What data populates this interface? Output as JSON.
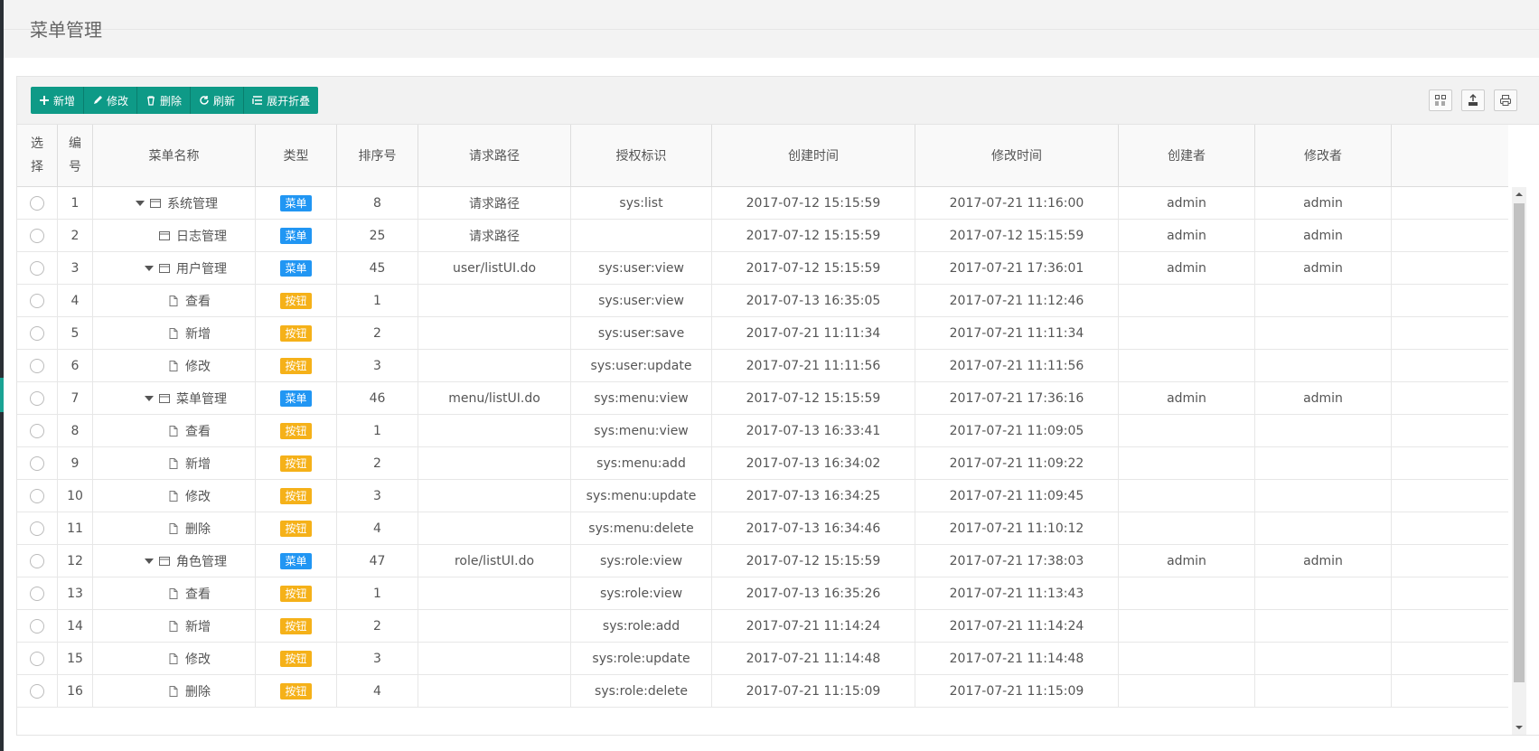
{
  "header": {
    "title": "菜单管理"
  },
  "toolbar": {
    "buttons": [
      {
        "label": "新增"
      },
      {
        "label": "修改"
      },
      {
        "label": "删除"
      },
      {
        "label": "刷新"
      },
      {
        "label": "展开折叠"
      }
    ],
    "icons": [
      "columns-icon",
      "export-icon",
      "print-icon"
    ]
  },
  "table": {
    "columns": [
      "选择",
      "编号",
      "菜单名称",
      "类型",
      "排序号",
      "请求路径",
      "授权标识",
      "创建时间",
      "修改时间",
      "创建者",
      "修改者"
    ],
    "rows": [
      {
        "id": "1",
        "name": "系统管理",
        "level": 0,
        "node": "folder-expanded",
        "type": "菜单",
        "kind": "menu",
        "sort": "8",
        "url": "请求路径",
        "perm": "sys:list",
        "created": "2017-07-12 15:15:59",
        "modified": "2017-07-21 11:16:00",
        "creator": "admin",
        "modifier": "admin"
      },
      {
        "id": "2",
        "name": "日志管理",
        "level": 1,
        "node": "folder",
        "type": "菜单",
        "kind": "menu",
        "sort": "25",
        "url": "请求路径",
        "perm": "",
        "created": "2017-07-12 15:15:59",
        "modified": "2017-07-12 15:15:59",
        "creator": "admin",
        "modifier": "admin"
      },
      {
        "id": "3",
        "name": "用户管理",
        "level": 1,
        "node": "folder-expanded",
        "type": "菜单",
        "kind": "menu",
        "sort": "45",
        "url": "user/listUI.do",
        "perm": "sys:user:view",
        "created": "2017-07-12 15:15:59",
        "modified": "2017-07-21 17:36:01",
        "creator": "admin",
        "modifier": "admin"
      },
      {
        "id": "4",
        "name": "查看",
        "level": 2,
        "node": "file",
        "type": "按钮",
        "kind": "button",
        "sort": "1",
        "url": "",
        "perm": "sys:user:view",
        "created": "2017-07-13 16:35:05",
        "modified": "2017-07-21 11:12:46",
        "creator": "",
        "modifier": ""
      },
      {
        "id": "5",
        "name": "新增",
        "level": 2,
        "node": "file",
        "type": "按钮",
        "kind": "button",
        "sort": "2",
        "url": "",
        "perm": "sys:user:save",
        "created": "2017-07-21 11:11:34",
        "modified": "2017-07-21 11:11:34",
        "creator": "",
        "modifier": ""
      },
      {
        "id": "6",
        "name": "修改",
        "level": 2,
        "node": "file",
        "type": "按钮",
        "kind": "button",
        "sort": "3",
        "url": "",
        "perm": "sys:user:update",
        "created": "2017-07-21 11:11:56",
        "modified": "2017-07-21 11:11:56",
        "creator": "",
        "modifier": ""
      },
      {
        "id": "7",
        "name": "菜单管理",
        "level": 1,
        "node": "folder-expanded",
        "type": "菜单",
        "kind": "menu",
        "sort": "46",
        "url": "menu/listUI.do",
        "perm": "sys:menu:view",
        "created": "2017-07-12 15:15:59",
        "modified": "2017-07-21 17:36:16",
        "creator": "admin",
        "modifier": "admin"
      },
      {
        "id": "8",
        "name": "查看",
        "level": 2,
        "node": "file",
        "type": "按钮",
        "kind": "button",
        "sort": "1",
        "url": "",
        "perm": "sys:menu:view",
        "created": "2017-07-13 16:33:41",
        "modified": "2017-07-21 11:09:05",
        "creator": "",
        "modifier": ""
      },
      {
        "id": "9",
        "name": "新增",
        "level": 2,
        "node": "file",
        "type": "按钮",
        "kind": "button",
        "sort": "2",
        "url": "",
        "perm": "sys:menu:add",
        "created": "2017-07-13 16:34:02",
        "modified": "2017-07-21 11:09:22",
        "creator": "",
        "modifier": ""
      },
      {
        "id": "10",
        "name": "修改",
        "level": 2,
        "node": "file",
        "type": "按钮",
        "kind": "button",
        "sort": "3",
        "url": "",
        "perm": "sys:menu:update",
        "created": "2017-07-13 16:34:25",
        "modified": "2017-07-21 11:09:45",
        "creator": "",
        "modifier": ""
      },
      {
        "id": "11",
        "name": "删除",
        "level": 2,
        "node": "file",
        "type": "按钮",
        "kind": "button",
        "sort": "4",
        "url": "",
        "perm": "sys:menu:delete",
        "created": "2017-07-13 16:34:46",
        "modified": "2017-07-21 11:10:12",
        "creator": "",
        "modifier": ""
      },
      {
        "id": "12",
        "name": "角色管理",
        "level": 1,
        "node": "folder-expanded",
        "type": "菜单",
        "kind": "menu",
        "sort": "47",
        "url": "role/listUI.do",
        "perm": "sys:role:view",
        "created": "2017-07-12 15:15:59",
        "modified": "2017-07-21 17:38:03",
        "creator": "admin",
        "modifier": "admin"
      },
      {
        "id": "13",
        "name": "查看",
        "level": 2,
        "node": "file",
        "type": "按钮",
        "kind": "button",
        "sort": "1",
        "url": "",
        "perm": "sys:role:view",
        "created": "2017-07-13 16:35:26",
        "modified": "2017-07-21 11:13:43",
        "creator": "",
        "modifier": ""
      },
      {
        "id": "14",
        "name": "新增",
        "level": 2,
        "node": "file",
        "type": "按钮",
        "kind": "button",
        "sort": "2",
        "url": "",
        "perm": "sys:role:add",
        "created": "2017-07-21 11:14:24",
        "modified": "2017-07-21 11:14:24",
        "creator": "",
        "modifier": ""
      },
      {
        "id": "15",
        "name": "修改",
        "level": 2,
        "node": "file",
        "type": "按钮",
        "kind": "button",
        "sort": "3",
        "url": "",
        "perm": "sys:role:update",
        "created": "2017-07-21 11:14:48",
        "modified": "2017-07-21 11:14:48",
        "creator": "",
        "modifier": ""
      },
      {
        "id": "16",
        "name": "删除",
        "level": 2,
        "node": "file",
        "type": "按钮",
        "kind": "button",
        "sort": "4",
        "url": "",
        "perm": "sys:role:delete",
        "created": "2017-07-21 11:15:09",
        "modified": "2017-07-21 11:15:09",
        "creator": "",
        "modifier": ""
      }
    ]
  },
  "colors": {
    "primary": "#0e9a87",
    "menu_badge": "#2196f3",
    "button_badge": "#f5b119"
  }
}
